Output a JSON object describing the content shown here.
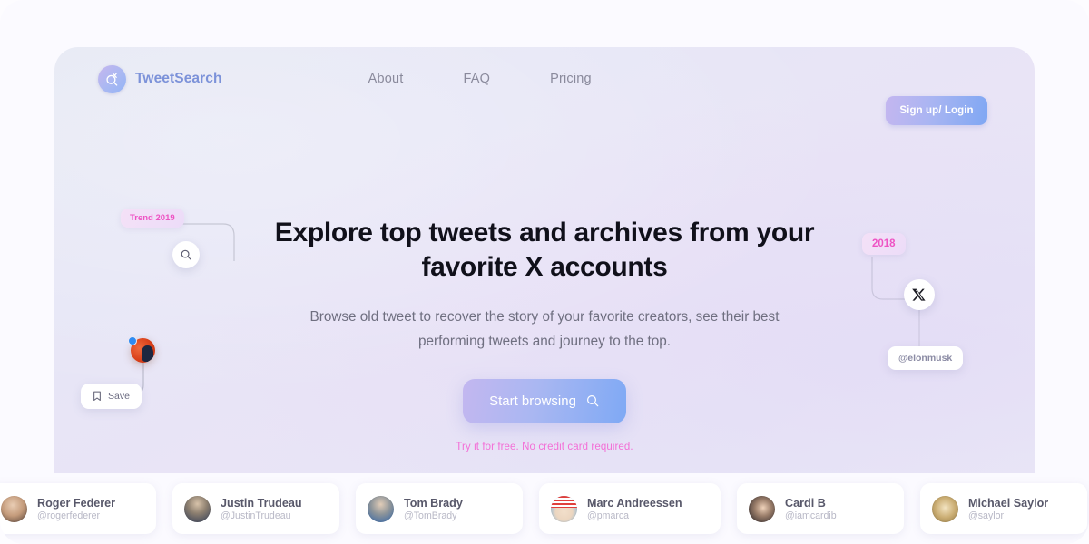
{
  "brand": {
    "name": "TweetSearch",
    "icon": "search-x-logo-icon",
    "accent": "#7c92d9"
  },
  "nav": {
    "links": [
      {
        "label": "About"
      },
      {
        "label": "FAQ"
      },
      {
        "label": "Pricing"
      }
    ],
    "signup_label": "Sign up/ Login"
  },
  "hero": {
    "headline": "Explore top tweets and archives from your favorite X accounts",
    "subhead": "Browse old tweet to recover the story of your favorite creators, see their best performing tweets and journey to the top.",
    "cta_label": "Start browsing",
    "cta_icon": "search-icon",
    "cta_note": "Try it for free. No credit card required.",
    "cta_note_color": "#f36fd7"
  },
  "decorations": {
    "trend_pill": "Trend 2019",
    "year_pill": "2018",
    "save_pill": "Save",
    "save_icon": "bookmark-icon",
    "handle_pill": "@elonmusk",
    "search_node_icon": "search-icon",
    "x_node_icon": "x-logo-icon",
    "avatar_node": "creator-avatar"
  },
  "creators": [
    {
      "name": "Roger Federer",
      "handle": "@rogerfederer",
      "avatar": "av-federer"
    },
    {
      "name": "Justin Trudeau",
      "handle": "@JustinTrudeau",
      "avatar": "av-trudeau"
    },
    {
      "name": "Tom Brady",
      "handle": "@TomBrady",
      "avatar": "av-brady"
    },
    {
      "name": "Marc Andreessen",
      "handle": "@pmarca",
      "avatar": "av-pmarca"
    },
    {
      "name": "Cardi B",
      "handle": "@iamcardib",
      "avatar": "av-cardi"
    },
    {
      "name": "Michael Saylor",
      "handle": "@saylor",
      "avatar": "av-saylor"
    }
  ]
}
